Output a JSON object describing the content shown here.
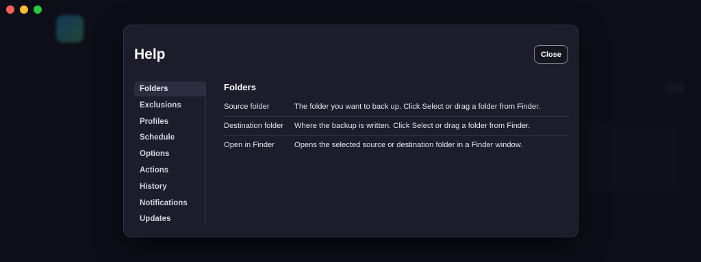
{
  "window": {
    "controls": [
      "close",
      "minimize",
      "zoom"
    ]
  },
  "help": {
    "title": "Help",
    "close_label": "Close",
    "nav": [
      {
        "label": "Folders",
        "active": true
      },
      {
        "label": "Exclusions",
        "active": false
      },
      {
        "label": "Profiles",
        "active": false
      },
      {
        "label": "Schedule",
        "active": false
      },
      {
        "label": "Options",
        "active": false
      },
      {
        "label": "Actions",
        "active": false
      },
      {
        "label": "History",
        "active": false
      },
      {
        "label": "Notifications",
        "active": false
      },
      {
        "label": "Updates",
        "active": false
      }
    ],
    "section": {
      "title": "Folders",
      "rows": [
        {
          "term": "Source folder",
          "description": "The folder you want to back up. Click Select or drag a folder from Finder."
        },
        {
          "term": "Destination folder",
          "description": "Where the backup is written. Click Select or drag a folder from Finder."
        },
        {
          "term": "Open in Finder",
          "description": "Opens the selected source or destination folder in a Finder window."
        }
      ]
    }
  },
  "colors": {
    "modal_bg": "#1c1c2b",
    "active_nav_bg": "#2c2d40",
    "traffic_red": "#fe5f57",
    "traffic_yellow": "#febc2e",
    "traffic_green": "#28c840"
  }
}
